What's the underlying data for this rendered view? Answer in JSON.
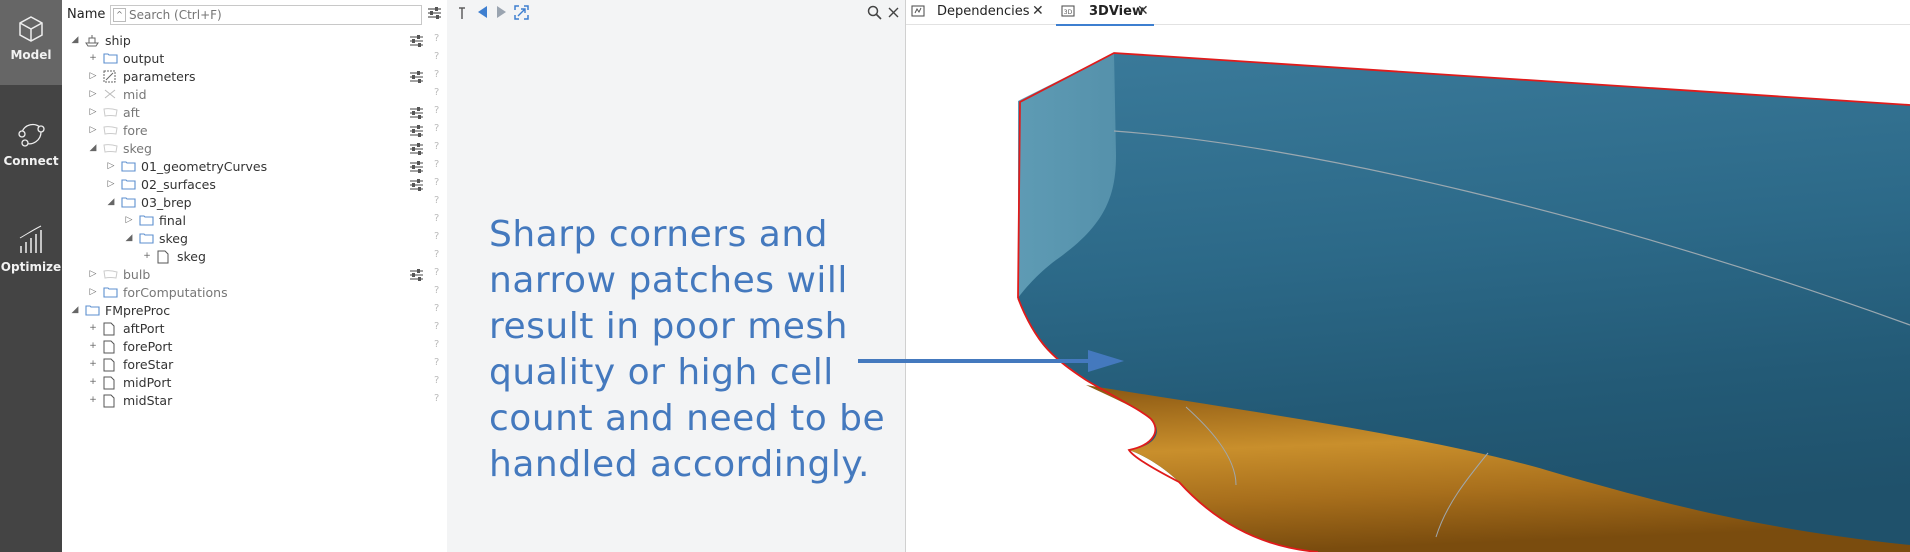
{
  "sidebar": {
    "items": [
      {
        "label": "Model",
        "icon": "cube-icon"
      },
      {
        "label": "Connect",
        "icon": "connect-icon"
      },
      {
        "label": "Optimize",
        "icon": "optimize-icon"
      }
    ]
  },
  "tree": {
    "header_label": "Name",
    "search_placeholder": "Search (Ctrl+F)",
    "rows": [
      {
        "label": "ship",
        "level": 0,
        "toggle": "◢",
        "icon": "ship-icon",
        "settings": true
      },
      {
        "label": "output",
        "level": 1,
        "toggle": "+",
        "icon": "folder-icon",
        "settings": false
      },
      {
        "label": "parameters",
        "level": 1,
        "toggle": "▷",
        "icon": "parameters-icon",
        "settings": true
      },
      {
        "label": "mid",
        "level": 1,
        "toggle": "▷",
        "icon": "mid-icon",
        "settings": false
      },
      {
        "label": "aft",
        "level": 1,
        "toggle": "▷",
        "icon": "surface-icon",
        "settings": true
      },
      {
        "label": "fore",
        "level": 1,
        "toggle": "▷",
        "icon": "surface-icon",
        "settings": true
      },
      {
        "label": "skeg",
        "level": 1,
        "toggle": "◢",
        "icon": "surface-icon",
        "settings": true
      },
      {
        "label": "01_geometryCurves",
        "level": 2,
        "toggle": "▷",
        "icon": "folder-icon",
        "settings": true
      },
      {
        "label": "02_surfaces",
        "level": 2,
        "toggle": "▷",
        "icon": "folder-icon",
        "settings": true
      },
      {
        "label": "03_brep",
        "level": 2,
        "toggle": "◢",
        "icon": "folder-icon",
        "settings": false
      },
      {
        "label": "final",
        "level": 3,
        "toggle": "▷",
        "icon": "folder-icon",
        "settings": false
      },
      {
        "label": "skeg",
        "level": 3,
        "toggle": "◢",
        "icon": "folder-icon",
        "settings": false
      },
      {
        "label": "skeg",
        "level": 4,
        "toggle": "+",
        "icon": "file-icon",
        "settings": false
      },
      {
        "label": "bulb",
        "level": 1,
        "toggle": "▷",
        "icon": "surface-icon",
        "settings": true
      },
      {
        "label": "forComputations",
        "level": 1,
        "toggle": "▷",
        "icon": "folder-icon",
        "settings": false
      },
      {
        "label": "FMpreProc",
        "level": 0,
        "toggle": "◢",
        "icon": "folder-icon",
        "settings": false
      },
      {
        "label": "aftPort",
        "level": 1,
        "toggle": "+",
        "icon": "file-icon",
        "settings": false
      },
      {
        "label": "forePort",
        "level": 1,
        "toggle": "+",
        "icon": "file-icon",
        "settings": false
      },
      {
        "label": "foreStar",
        "level": 1,
        "toggle": "+",
        "icon": "file-icon",
        "settings": false
      },
      {
        "label": "midPort",
        "level": 1,
        "toggle": "+",
        "icon": "file-icon",
        "settings": false
      },
      {
        "label": "midStar",
        "level": 1,
        "toggle": "+",
        "icon": "file-icon",
        "settings": false
      }
    ],
    "help_mark": "?"
  },
  "middle": {
    "callout_lines": [
      "Sharp corners and",
      "narrow patches will",
      "result in poor mesh",
      "quality or high cell",
      "count and need to be",
      "handled accordingly."
    ]
  },
  "tabs": [
    {
      "label": "Dependencies",
      "icon": "dependencies-icon",
      "active": false
    },
    {
      "label": "3DView",
      "icon": "3d-icon",
      "active": true
    }
  ],
  "colors": {
    "accent": "#3e7fd0",
    "callout": "#4479be",
    "hull_blue": "#2e6a88",
    "hull_gold": "#b27a1f",
    "edge_red": "#e01b1b"
  }
}
